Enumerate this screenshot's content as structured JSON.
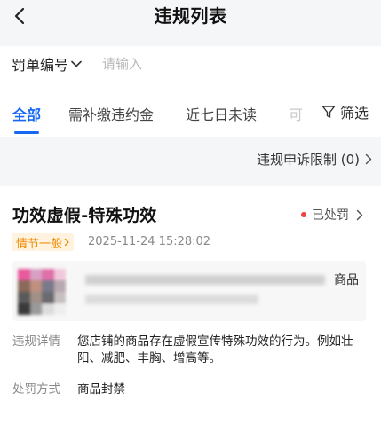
{
  "header": {
    "title": "违规列表",
    "back_icon": "chevron-left-icon"
  },
  "search": {
    "type_label": "罚单编号",
    "placeholder": "请输入",
    "value": ""
  },
  "tabs": [
    {
      "label": "全部",
      "active": true
    },
    {
      "label": "需补缴违约金",
      "active": false
    },
    {
      "label": "近七日未读",
      "active": false
    },
    {
      "label": "可",
      "active": false
    }
  ],
  "filter": {
    "label": "筛选",
    "icon": "funnel-icon"
  },
  "appeal_limit": {
    "label": "违规申诉限制 (0)"
  },
  "violation": {
    "title": "功效虚假-特殊功效",
    "status": "已处罚",
    "status_color": "#f04040",
    "severity": "情节一般",
    "time": "2025-11-24 15:28:02",
    "product_type": "商品",
    "details": [
      {
        "label": "违规详情",
        "value": "您店铺的商品存在虚假宣传特殊功效的行为。例如壮阳、减肥、丰胸、增高等。"
      },
      {
        "label": "处罚方式",
        "value": "商品封禁"
      }
    ]
  },
  "colors": {
    "accent": "#1668f2",
    "severity_bg": "#fff3e0",
    "severity_text": "#f08a00"
  }
}
